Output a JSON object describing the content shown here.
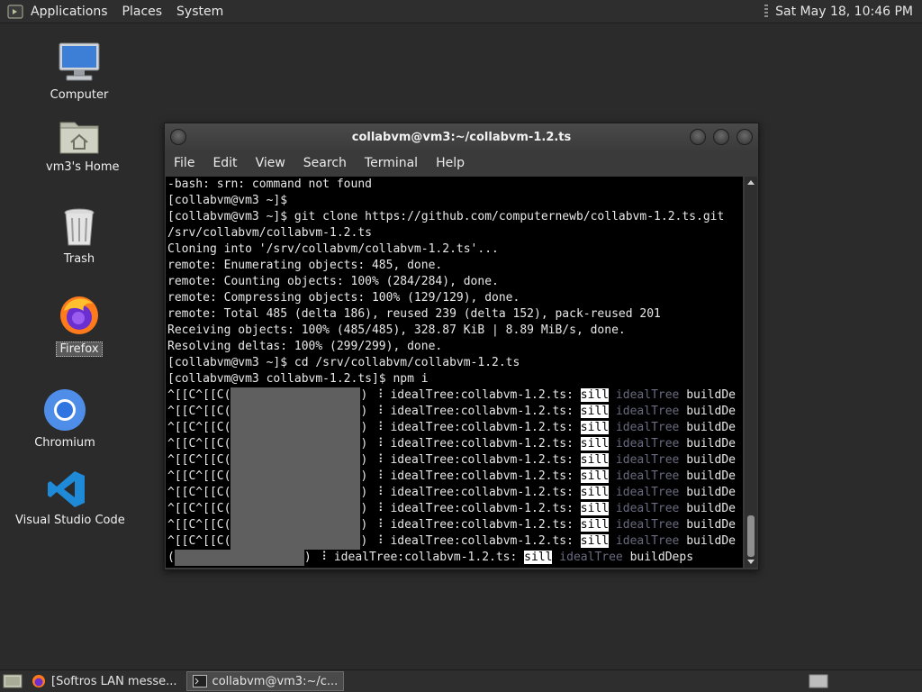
{
  "top_panel": {
    "menus": [
      "Applications",
      "Places",
      "System"
    ],
    "clock": "Sat May 18, 10:46 PM"
  },
  "desktop": {
    "icons": [
      {
        "label": "Computer"
      },
      {
        "label": "vm3's Home"
      },
      {
        "label": "Trash"
      },
      {
        "label": "Firefox"
      },
      {
        "label": "Chromium"
      },
      {
        "label": "Visual Studio Code"
      }
    ]
  },
  "window": {
    "title": "collabvm@vm3:~/collabvm-1.2.ts",
    "menu": [
      "File",
      "Edit",
      "View",
      "Search",
      "Terminal",
      "Help"
    ]
  },
  "terminal": {
    "lines": [
      "-bash: srn: command not found",
      "[collabvm@vm3 ~]$",
      "[collabvm@vm3 ~]$ git clone https://github.com/computernewb/collabvm-1.2.ts.git",
      "/srv/collabvm/collabvm-1.2.ts",
      "Cloning into '/srv/collabvm/collabvm-1.2.ts'...",
      "remote: Enumerating objects: 485, done.",
      "remote: Counting objects: 100% (284/284), done.",
      "remote: Compressing objects: 100% (129/129), done.",
      "remote: Total 485 (delta 186), reused 239 (delta 152), pack-reused 201",
      "Receiving objects: 100% (485/485), 328.87 KiB | 8.89 MiB/s, done.",
      "Resolving deltas: 100% (299/299), done.",
      "[collabvm@vm3 ~]$ cd /srv/collabvm/collabvm-1.2.ts",
      "[collabvm@vm3 collabvm-1.2.ts]$ npm i"
    ],
    "progress_prefix": "^[[C^[[C(",
    "progress_close": ") ",
    "spinner": "⠸",
    "tree_text": " idealTree:collabvm-1.2.ts: ",
    "sill": "sill",
    "ideal": " idealTree ",
    "build": "buildDe",
    "build_full": "buildDeps",
    "last_prefix": "(",
    "progress_rows": 10
  },
  "taskbar": {
    "items": [
      {
        "label": "[Softros LAN messe..."
      },
      {
        "label": "collabvm@vm3:~/c..."
      }
    ]
  }
}
